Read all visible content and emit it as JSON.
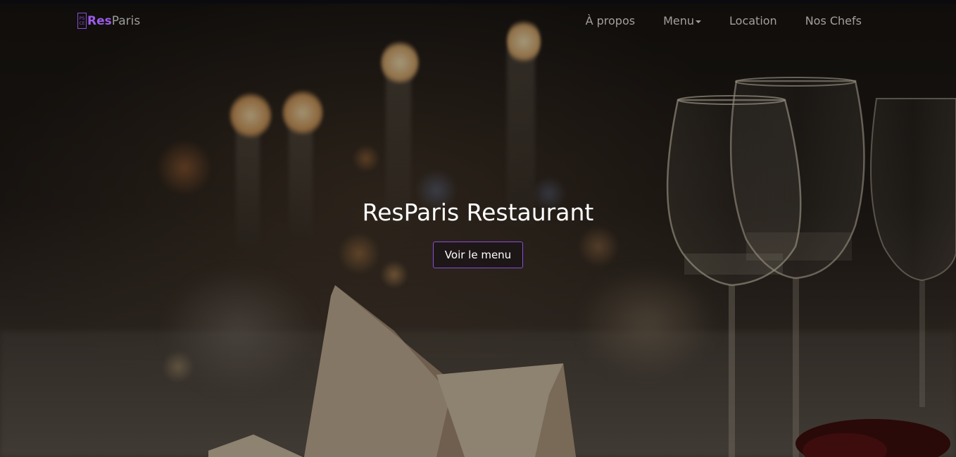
{
  "brand": {
    "logo_icon": "ps-ce-monogram-icon",
    "logo_line1": "PS",
    "logo_line2": "CE",
    "name_part1": "Res",
    "name_part2": "Paris"
  },
  "nav": {
    "items": [
      {
        "label": "À propos"
      },
      {
        "label": "Menu",
        "has_dropdown": true
      },
      {
        "label": "Location"
      },
      {
        "label": "Nos Chefs"
      }
    ]
  },
  "hero": {
    "title": "ResParis Restaurant",
    "button_label": "Voir le menu",
    "background_image": "restaurant-table-with-wine-glasses-and-candles"
  },
  "colors": {
    "accent": "#8a4ed6",
    "brand_res": "#9b5de5",
    "nav_text": "#a3a09c",
    "hero_text": "#ffffff"
  }
}
